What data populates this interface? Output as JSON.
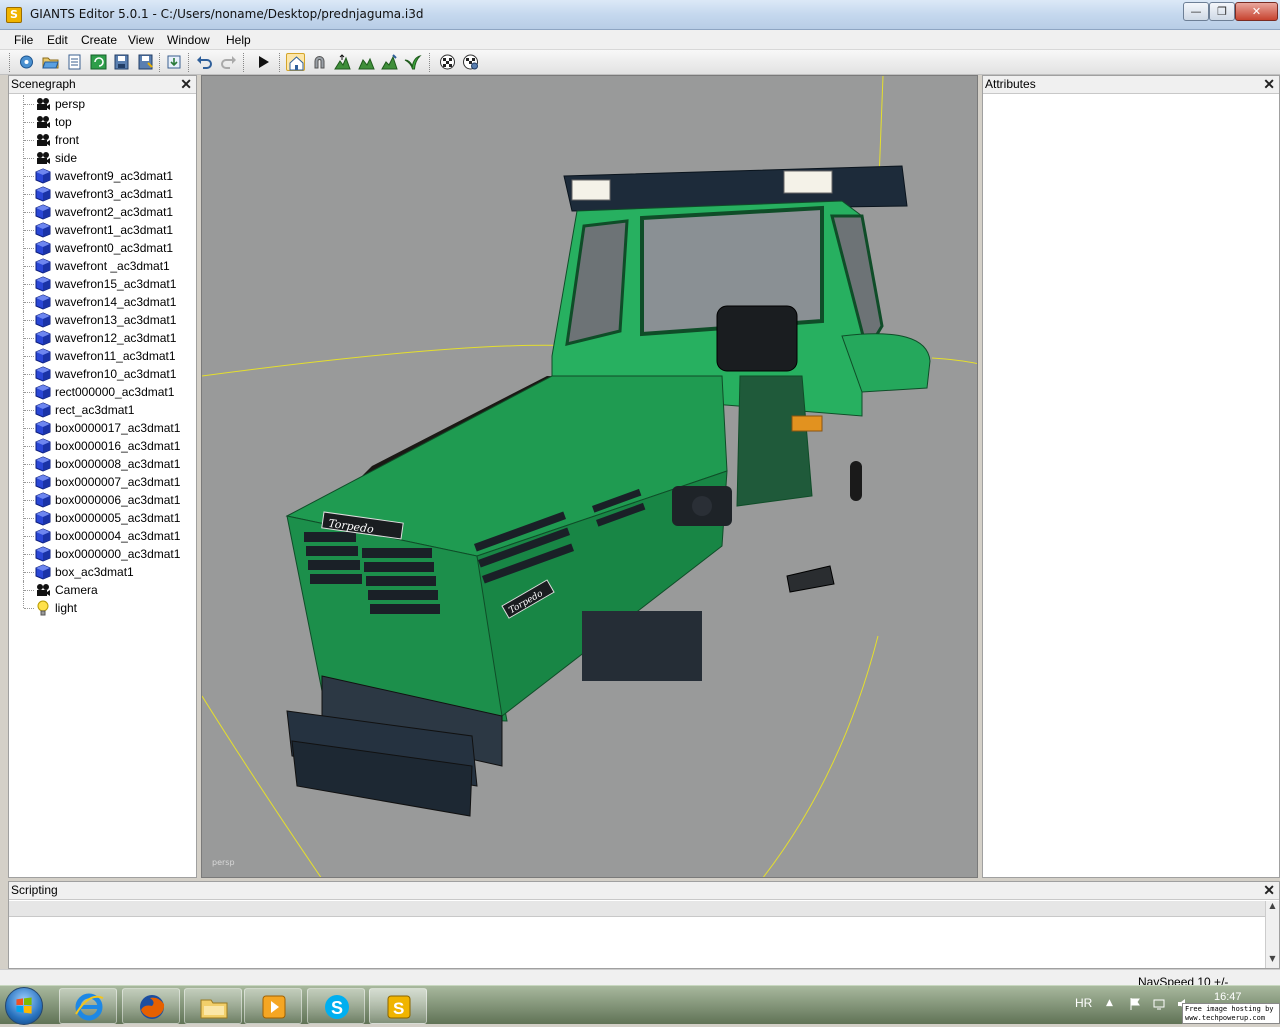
{
  "window": {
    "title": "GIANTS Editor 5.0.1 - C:/Users/noname/Desktop/prednjaguma.i3d",
    "app_icon_letter": "S",
    "minimize_glyph": "—",
    "maximize_glyph": "❐",
    "close_glyph": "✕"
  },
  "menu": [
    "File",
    "Edit",
    "Create",
    "View",
    "Window",
    "Help"
  ],
  "toolbar_icons": [
    "new-icon",
    "open-icon",
    "properties-icon",
    "refresh-icon",
    "save-icon",
    "save-as-icon",
    "import-icon",
    "undo-icon",
    "redo-icon",
    "play-icon",
    "home-icon",
    "magnet-icon",
    "terrain-raise-icon",
    "terrain-smooth-icon",
    "terrain-paint-icon",
    "foliage-icon",
    "checker-icon",
    "checker-settings-icon"
  ],
  "scenegraph": {
    "title": "Scenegraph",
    "close": "✕",
    "items": [
      {
        "label": "persp",
        "icon": "camera-icon"
      },
      {
        "label": "top",
        "icon": "camera-icon"
      },
      {
        "label": "front",
        "icon": "camera-icon"
      },
      {
        "label": "side",
        "icon": "camera-icon"
      },
      {
        "label": "wavefront9_ac3dmat1",
        "icon": "shape-icon"
      },
      {
        "label": "wavefront3_ac3dmat1",
        "icon": "shape-icon"
      },
      {
        "label": "wavefront2_ac3dmat1",
        "icon": "shape-icon"
      },
      {
        "label": "wavefront1_ac3dmat1",
        "icon": "shape-icon"
      },
      {
        "label": "wavefront0_ac3dmat1",
        "icon": "shape-icon"
      },
      {
        "label": "wavefront _ac3dmat1",
        "icon": "shape-icon"
      },
      {
        "label": "wavefron15_ac3dmat1",
        "icon": "shape-icon"
      },
      {
        "label": "wavefron14_ac3dmat1",
        "icon": "shape-icon"
      },
      {
        "label": "wavefron13_ac3dmat1",
        "icon": "shape-icon"
      },
      {
        "label": "wavefron12_ac3dmat1",
        "icon": "shape-icon"
      },
      {
        "label": "wavefron11_ac3dmat1",
        "icon": "shape-icon"
      },
      {
        "label": "wavefron10_ac3dmat1",
        "icon": "shape-icon"
      },
      {
        "label": "rect000000_ac3dmat1",
        "icon": "shape-icon"
      },
      {
        "label": "rect_ac3dmat1",
        "icon": "shape-icon"
      },
      {
        "label": "box0000017_ac3dmat1",
        "icon": "shape-icon"
      },
      {
        "label": "box0000016_ac3dmat1",
        "icon": "shape-icon"
      },
      {
        "label": "box0000008_ac3dmat1",
        "icon": "shape-icon"
      },
      {
        "label": "box0000007_ac3dmat1",
        "icon": "shape-icon"
      },
      {
        "label": "box0000006_ac3dmat1",
        "icon": "shape-icon"
      },
      {
        "label": "box0000005_ac3dmat1",
        "icon": "shape-icon"
      },
      {
        "label": "box0000004_ac3dmat1",
        "icon": "shape-icon"
      },
      {
        "label": "box0000000_ac3dmat1",
        "icon": "shape-icon"
      },
      {
        "label": "box_ac3dmat1",
        "icon": "shape-icon"
      },
      {
        "label": "Camera",
        "icon": "camera-icon"
      },
      {
        "label": "light",
        "icon": "light-bulb-icon"
      }
    ]
  },
  "viewport": {
    "camera_label": "persp",
    "background": "#999a9a",
    "model_badge_text": "Torpedo",
    "model_color": "#1fa055"
  },
  "attributes": {
    "title": "Attributes",
    "close": "✕"
  },
  "scripting": {
    "title": "Scripting",
    "close": "✕",
    "scroll_up": "▲",
    "scroll_down": "▼"
  },
  "status": {
    "navspeed": "NavSpeed 10 +/-"
  },
  "taskbar": {
    "apps": [
      "internet-explorer-icon",
      "firefox-icon",
      "file-explorer-icon",
      "media-player-icon",
      "skype-icon",
      "giants-editor-icon"
    ],
    "language": "HR",
    "tray_arrow": "▲",
    "time": "16:47",
    "watermark_line1": "Free image hosting by",
    "watermark_line2": "www.techpowerup.com"
  }
}
